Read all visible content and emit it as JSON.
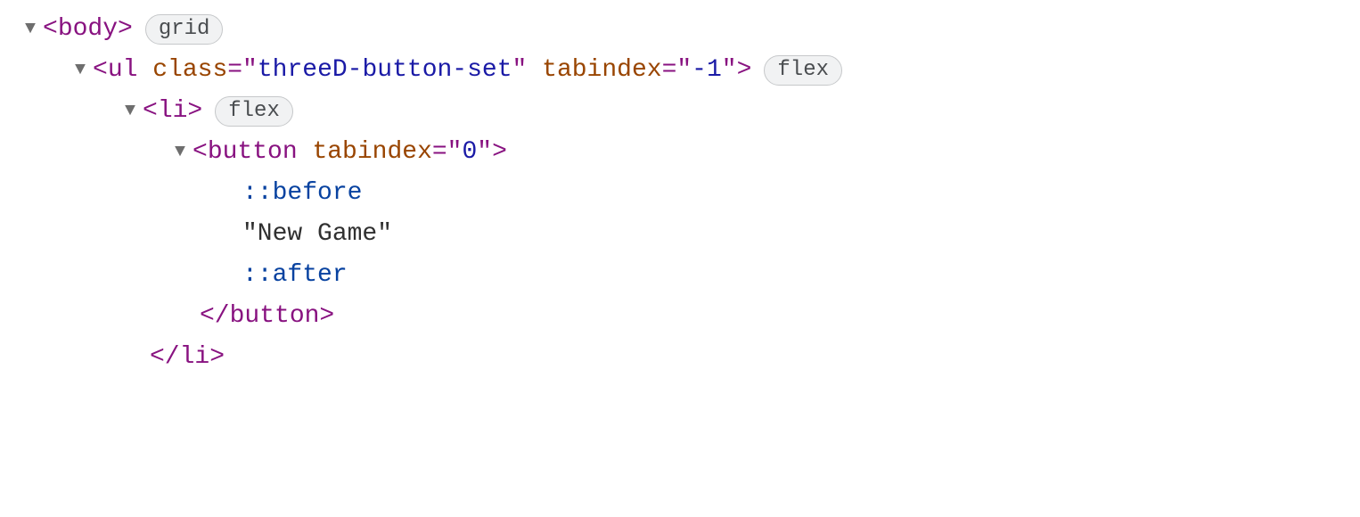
{
  "rows": {
    "r0": {
      "tag_open": "<",
      "tag_name": "body",
      "tag_close": ">",
      "badge": "grid"
    },
    "r1": {
      "tag_open": "<",
      "tag_name": "ul",
      "attr1_name": "class",
      "eq": "=\"",
      "attr1_val": "threeD-button-set",
      "q": "\"",
      "attr2_name": "tabindex",
      "attr2_val": "-1",
      "tag_close": ">",
      "badge": "flex"
    },
    "r2": {
      "tag_open": "<",
      "tag_name": "li",
      "tag_close": ">",
      "badge": "flex"
    },
    "r3": {
      "tag_open": "<",
      "tag_name": "button",
      "attr1_name": "tabindex",
      "eq": "=\"",
      "attr1_val": "0",
      "q": "\"",
      "tag_close": ">"
    },
    "r4": {
      "pseudo": "::before"
    },
    "r5": {
      "text": "\"New Game\""
    },
    "r6": {
      "pseudo": "::after"
    },
    "r7": {
      "close": "</button>"
    },
    "r8": {
      "close": "</li>"
    }
  }
}
